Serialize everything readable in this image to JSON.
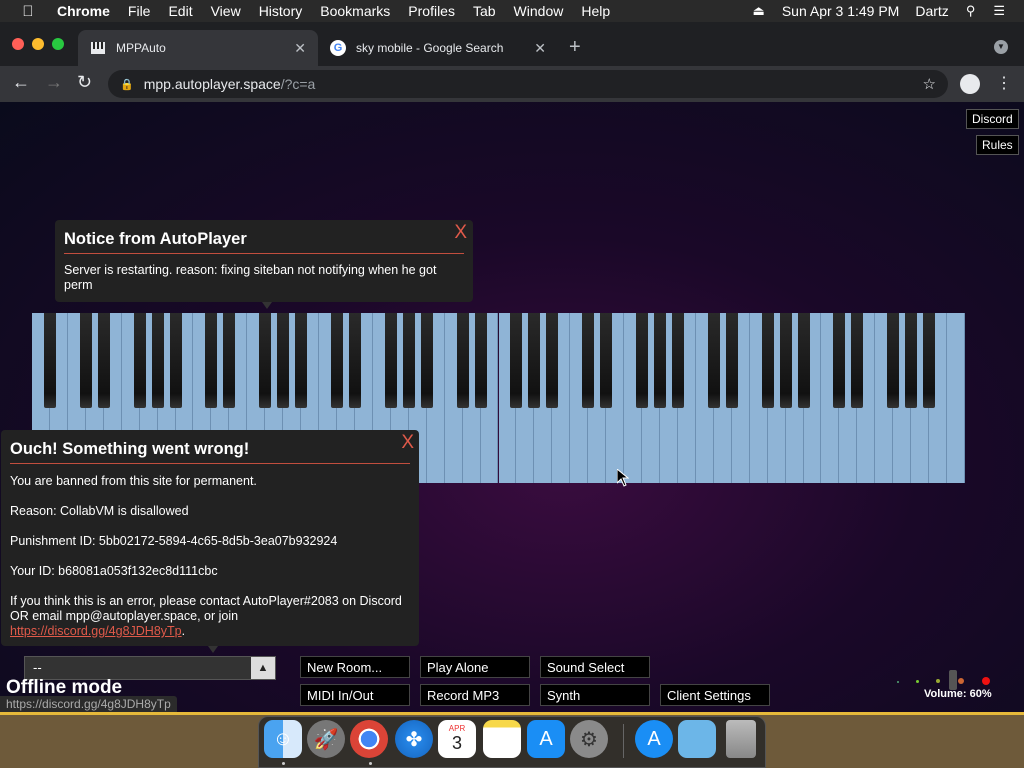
{
  "menubar": {
    "apple_icon": "apple-icon",
    "items": [
      "Chrome",
      "File",
      "Edit",
      "View",
      "History",
      "Bookmarks",
      "Profiles",
      "Tab",
      "Window",
      "Help"
    ],
    "datetime": "Sun Apr 3  1:49 PM",
    "user": "Dartz"
  },
  "tabs": [
    {
      "title": "MPPAuto",
      "active": true,
      "favicon": "piano-icon"
    },
    {
      "title": "sky mobile - Google Search",
      "active": false,
      "favicon": "google-icon"
    }
  ],
  "omnibox": {
    "host": "mpp.autoplayer.space",
    "path": "/?c=a"
  },
  "page": {
    "discord_label": "Discord",
    "rules_label": "Rules",
    "notice1": {
      "title": "Notice from AutoPlayer",
      "close": "X",
      "message": "Server is restarting. reason: fixing siteban not notifying when he got perm"
    },
    "notice2": {
      "title": "Ouch! Something went wrong!",
      "close": "X",
      "line1": "You are banned from this site for permanent.",
      "line2": "Reason: CollabVM is disallowed",
      "line3": "Punishment ID: 5bb02172-5894-4c65-8d5b-3ea07b932924",
      "line4": "Your ID: b68081a053f132ec8d111cbc",
      "line5": "If you think this is an error, please contact AutoPlayer#2083 on Discord OR email mpp@autoplayer.space, or join ",
      "link": "https://discord.gg/4g8JDH8yTp",
      "line5_end": "."
    },
    "room_select_value": "--",
    "buttons": {
      "new_room": "New Room...",
      "play_alone": "Play Alone",
      "sound_select": "Sound Select",
      "midi": "MIDI In/Out",
      "record": "Record MP3",
      "synth": "Synth",
      "client_settings": "Client Settings"
    },
    "offline_mode": "Offline mode",
    "status_url": "https://discord.gg/4g8JDH8yTp",
    "volume": "Volume: 60%"
  },
  "colors": {
    "key_white": "#8fb4d6",
    "notice_accent": "#e05a4a",
    "dock_bg": "#6e5a3a"
  },
  "dock": {
    "apps": [
      "finder-icon",
      "launchpad-icon",
      "chrome-icon",
      "safari-icon",
      "calendar-icon",
      "notes-icon",
      "app-store-icon",
      "system-preferences-icon",
      "app-store-2-icon",
      "downloads-folder-icon",
      "trash-icon"
    ],
    "calendar_month": "APR",
    "calendar_day": "3"
  }
}
